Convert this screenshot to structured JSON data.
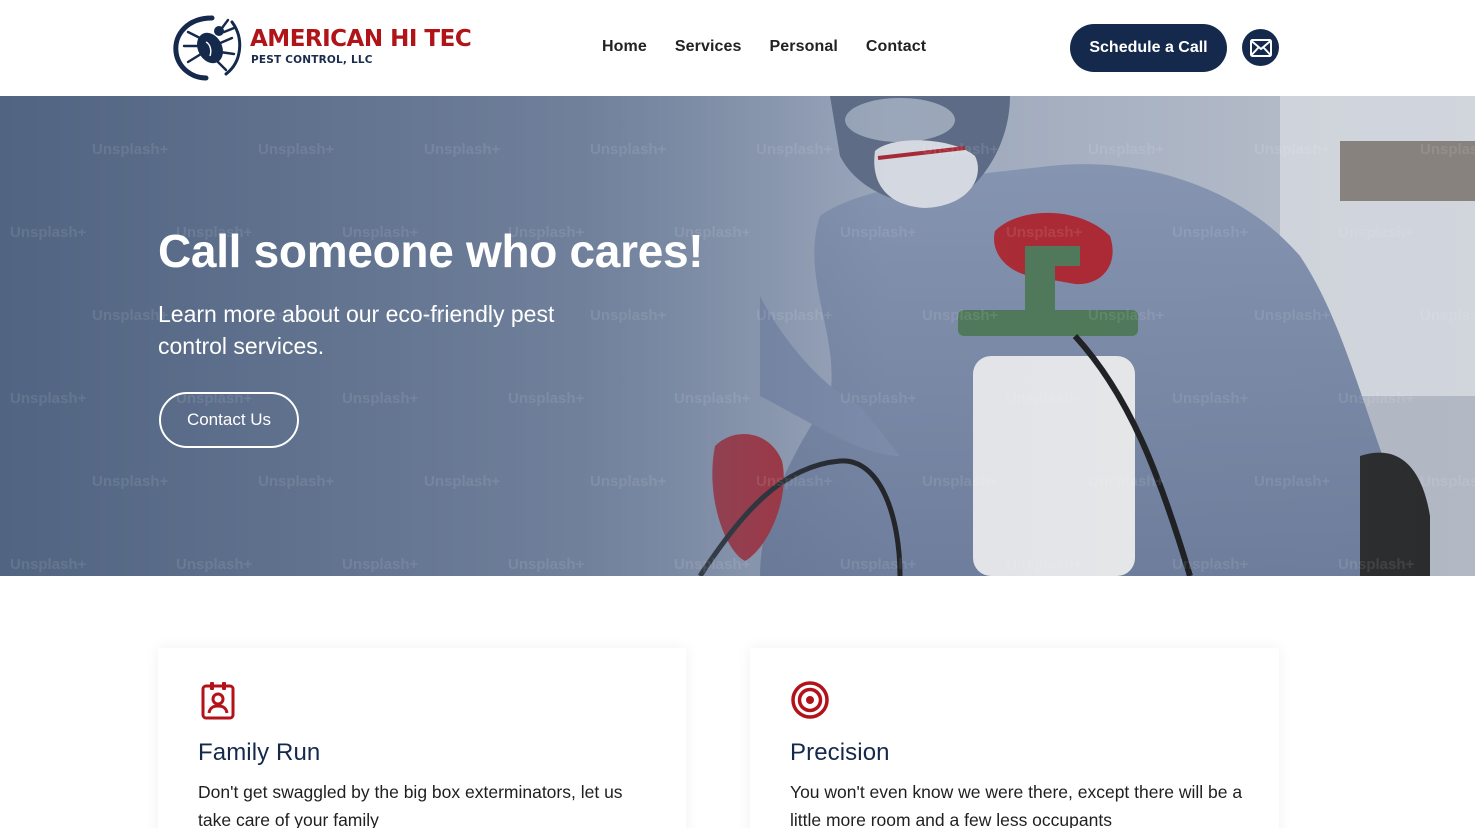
{
  "header": {
    "logo": {
      "title": "AMERICAN HI TEC",
      "subtitle": "PEST CONTROL, LLC",
      "icon": "tick-bug-logo-icon"
    },
    "nav": [
      {
        "label": "Home"
      },
      {
        "label": "Services"
      },
      {
        "label": "Personal"
      },
      {
        "label": "Contact"
      }
    ],
    "cta_label": "Schedule a Call",
    "mail_icon": "envelope-icon"
  },
  "hero": {
    "title": "Call someone who cares!",
    "subtitle": "Learn more about our eco-friendly pest control services.",
    "button_label": "Contact Us",
    "watermark": "Unsplash+"
  },
  "features": [
    {
      "icon": "id-badge-icon",
      "title": "Family Run",
      "text": "Don't get swaggled by the big box exterminators, let us take care of your family"
    },
    {
      "icon": "target-icon",
      "title": "Precision",
      "text": "You won't even know we were there, except there will be a little more room and a few less occupants"
    }
  ],
  "colors": {
    "brand_red": "#b01419",
    "brand_navy": "#15294d",
    "icon_red": "#b3121a"
  }
}
